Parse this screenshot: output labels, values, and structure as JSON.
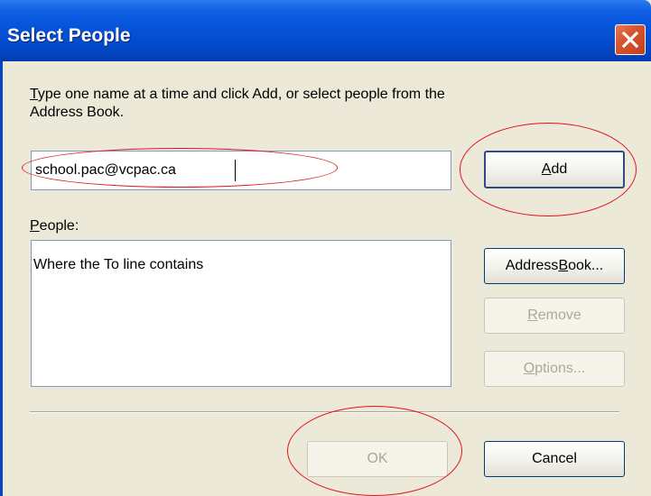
{
  "dialog": {
    "title": "Select People",
    "close_icon": "close-x-icon",
    "instructions": {
      "prefix_hotkey": "T",
      "text_rest": "ype one name at a time and click Add, or select people from the",
      "line2": "Address Book."
    },
    "name_input_value": "school.pac@vcpac.ca",
    "add_button": {
      "hotkey": "A",
      "rest": "dd"
    },
    "people_label": {
      "hotkey": "P",
      "rest": "eople:"
    },
    "people_list_items": [
      "Where the To line contains"
    ],
    "address_book_button": {
      "prefix": "Address ",
      "hotkey": "B",
      "rest": "ook..."
    },
    "remove_button": {
      "hotkey": "R",
      "rest": "emove"
    },
    "options_button": {
      "hotkey": "O",
      "rest": "ptions..."
    },
    "ok_label": "OK",
    "cancel_label": "Cancel"
  },
  "colors": {
    "titlebar": "#0553d9",
    "dialog_bg": "#ece9d8",
    "annotation": "#e3131b",
    "disabled_text": "#aca899"
  }
}
